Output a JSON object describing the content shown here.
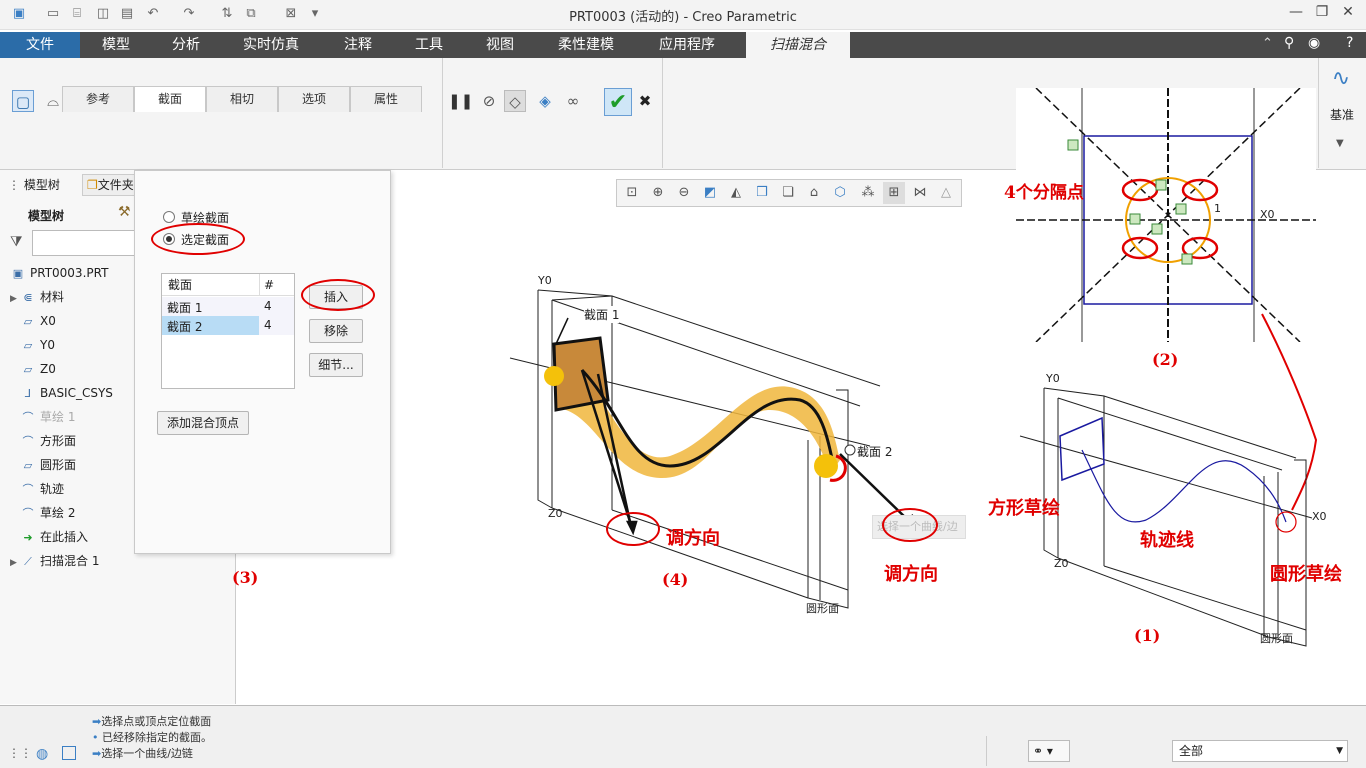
{
  "window": {
    "title": "PRT0003 (活动的) - Creo Parametric"
  },
  "menu": {
    "tabs": [
      "文件",
      "模型",
      "分析",
      "实时仿真",
      "注释",
      "工具",
      "视图",
      "柔性建模",
      "应用程序",
      "扫描混合"
    ]
  },
  "ribbon": {
    "subtabs": [
      "参考",
      "截面",
      "相切",
      "选项",
      "属性"
    ],
    "datum_label": "基准"
  },
  "model_tree": {
    "tab_label": "模型树",
    "tab2_label": "文件夹",
    "header": "模型树",
    "items": [
      {
        "icon": "part-icon",
        "label": "PRT0003.PRT"
      },
      {
        "icon": "material-icon",
        "label": "材料",
        "expandable": true
      },
      {
        "icon": "plane-icon",
        "label": "X0"
      },
      {
        "icon": "plane-icon",
        "label": "Y0"
      },
      {
        "icon": "plane-icon",
        "label": "Z0"
      },
      {
        "icon": "csys-icon",
        "label": "BASIC_CSYS"
      },
      {
        "icon": "sketch-icon",
        "label": "草绘 1"
      },
      {
        "icon": "sketch-icon",
        "label": "方形面"
      },
      {
        "icon": "plane-icon",
        "label": "圆形面"
      },
      {
        "icon": "sketch-icon",
        "label": "轨迹"
      },
      {
        "icon": "sketch-icon",
        "label": "草绘 2"
      },
      {
        "icon": "insert-arrow-icon",
        "label": "在此插入"
      },
      {
        "icon": "sweep-blend-icon",
        "label": "扫描混合 1",
        "expandable": true
      }
    ]
  },
  "section_panel": {
    "radio_sketch": "草绘截面",
    "radio_selected": "选定截面",
    "table_headers": [
      "截面",
      "#"
    ],
    "rows": [
      {
        "name": "截面 1",
        "count": "4"
      },
      {
        "name": "截面 2",
        "count": "4"
      }
    ],
    "insert_button": "插入",
    "remove_button": "移除",
    "details_button": "细节...",
    "add_vertex_button": "添加混合顶点"
  },
  "annotations": {
    "step3": "(3)",
    "step4": "(4)",
    "step2": "(2)",
    "step1": "(1)",
    "adjust_dir_1": "调方向",
    "adjust_dir_2": "调方向",
    "four_points": "4个分隔点",
    "square_sketch": "方形草绘",
    "trajectory": "轨迹线",
    "circle_sketch": "圆形草绘"
  },
  "view_labels": {
    "y0": "Y0",
    "z0": "Z0",
    "x0": "X0",
    "section1": "截面 1",
    "section2": "截面 2",
    "circle_face": "圆形面",
    "hint": "选择一个曲线/边",
    "one": "1"
  },
  "status": {
    "messages": [
      "选择点或顶点定位截面",
      "已经移除指定的截面。",
      "选择一个曲线/边链"
    ],
    "filter": "全部"
  },
  "colors": {
    "accent": "#2b6ca8",
    "menubar": "#4a4a4a",
    "annotation": "#e00000",
    "solid": "#f0b63c"
  }
}
